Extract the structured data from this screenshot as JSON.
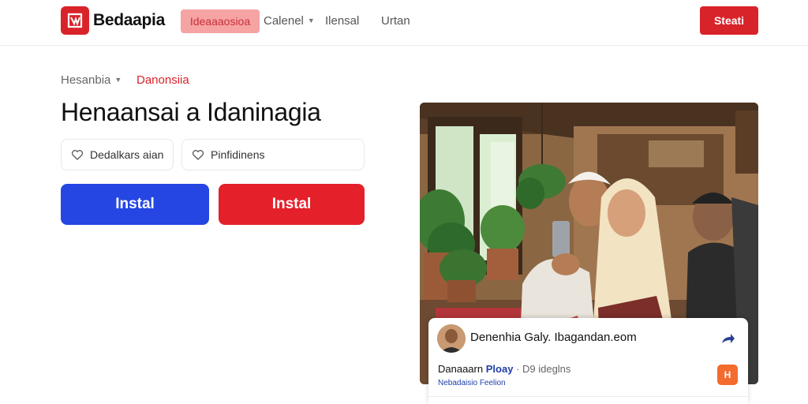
{
  "header": {
    "brand": "Bedaapia",
    "nav": [
      {
        "label": "Ideaaaosioa",
        "active": true
      },
      {
        "label": "Calenel",
        "has_dropdown": true
      },
      {
        "label": "Ilensal"
      },
      {
        "label": "Urtan"
      }
    ],
    "cta_label": "Steati"
  },
  "breadcrumb": {
    "parent": "Hesanbia",
    "current": "Danonsiia"
  },
  "main": {
    "title": "Henaansai a Idaninagia",
    "chips": [
      {
        "label": "Dedalkars aian",
        "icon": "heart-icon"
      },
      {
        "label": "Pinfidinens",
        "icon": "heart-icon"
      }
    ],
    "primary_button": "Instal",
    "secondary_button": "Instal"
  },
  "card": {
    "name": "Denenhia Galy. Ibagandan.eom",
    "line2_name": "Danaaarn",
    "line2_highlight": "Ploay",
    "line2_muted": "· D9 ideglns",
    "line3": "Nebadaisio Feelion",
    "badge": "H"
  },
  "colors": {
    "brand_red": "#d9232b",
    "primary_blue": "#2546e3",
    "accent_orange": "#f36b2f"
  }
}
